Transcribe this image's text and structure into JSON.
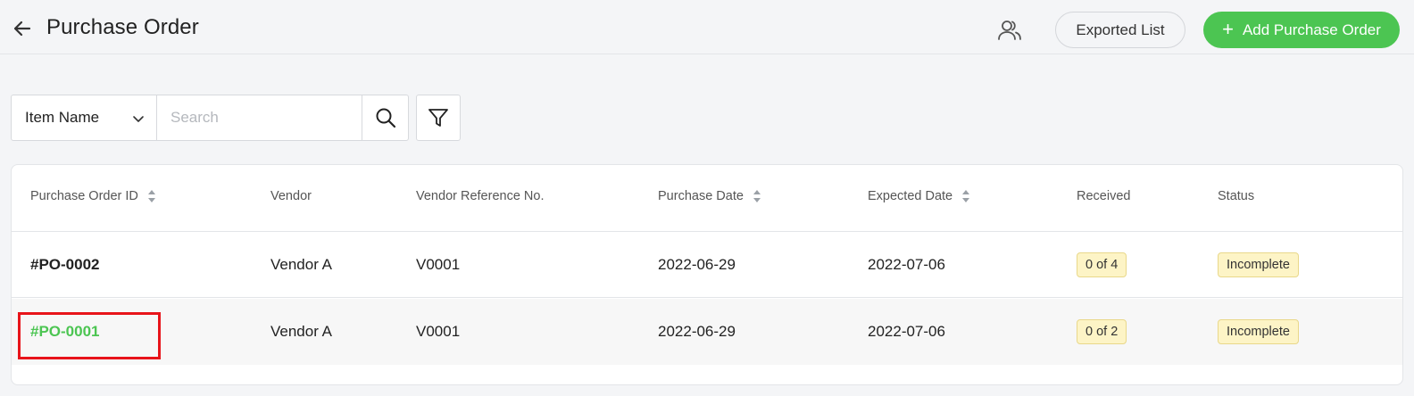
{
  "header": {
    "title": "Purchase Order",
    "exported_list_label": "Exported List",
    "add_button_label": "Add Purchase Order",
    "icons": {
      "back": "arrow-left-icon",
      "users": "users-icon",
      "add": "plus-icon"
    }
  },
  "search": {
    "field_select_value": "Item Name",
    "placeholder": "Search",
    "icons": {
      "select": "chevron-down-icon",
      "search": "search-icon",
      "filter": "filter-icon"
    }
  },
  "table": {
    "columns": [
      "Purchase Order ID",
      "Vendor",
      "Vendor Reference No.",
      "Purchase Date",
      "Expected Date",
      "Received",
      "Status"
    ],
    "sortable_columns": [
      "Purchase Order ID",
      "Purchase Date",
      "Expected Date"
    ],
    "rows": [
      {
        "id": "#PO-0002",
        "vendor": "Vendor A",
        "vendor_ref": "V0001",
        "purchase_date": "2022-06-29",
        "expected_date": "2022-07-06",
        "received": "0 of 4",
        "status": "Incomplete"
      },
      {
        "id": "#PO-0001",
        "vendor": "Vendor A",
        "vendor_ref": "V0001",
        "purchase_date": "2022-06-29",
        "expected_date": "2022-07-06",
        "received": "0 of 2",
        "status": "Incomplete"
      }
    ]
  },
  "colors": {
    "accent": "#4cc552",
    "badge_bg": "#fdf4c6",
    "badge_border": "#e9d88a",
    "highlight": "#e8141a"
  }
}
